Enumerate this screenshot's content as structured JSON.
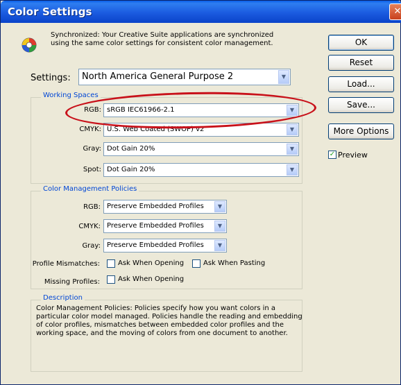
{
  "window": {
    "title": "Color Settings",
    "close": "✕"
  },
  "sync": {
    "text": "Synchronized: Your Creative Suite applications are synchronized using the same color settings for consistent color management."
  },
  "settings": {
    "label": "Settings:",
    "value": "North America General Purpose 2"
  },
  "working_spaces": {
    "legend": "Working Spaces",
    "rgb": {
      "label": "RGB:",
      "value": "sRGB IEC61966-2.1"
    },
    "cmyk": {
      "label": "CMYK:",
      "value": "U.S. Web Coated (SWOP) v2"
    },
    "gray": {
      "label": "Gray:",
      "value": "Dot Gain 20%"
    },
    "spot": {
      "label": "Spot:",
      "value": "Dot Gain 20%"
    }
  },
  "policies": {
    "legend": "Color Management Policies",
    "rgb": {
      "label": "RGB:",
      "value": "Preserve Embedded Profiles"
    },
    "cmyk": {
      "label": "CMYK:",
      "value": "Preserve Embedded Profiles"
    },
    "gray": {
      "label": "Gray:",
      "value": "Preserve Embedded Profiles"
    },
    "profile_mismatches": {
      "label": "Profile Mismatches:",
      "ask_opening": "Ask When Opening",
      "ask_pasting": "Ask When Pasting",
      "ask_opening_checked": false,
      "ask_pasting_checked": false
    },
    "missing_profiles": {
      "label": "Missing Profiles:",
      "ask_opening": "Ask When Opening",
      "ask_opening_checked": false
    }
  },
  "description": {
    "legend": "Description",
    "text": "Color Management Policies: Policies specify how you want colors in a particular color model managed. Policies handle the reading and embedding of color profiles, mismatches between embedded color profiles and the working space, and the moving of colors from one document to another."
  },
  "buttons": {
    "ok": "OK",
    "reset": "Reset",
    "load": "Load...",
    "save": "Save...",
    "more_options": "More Options"
  },
  "preview": {
    "label": "Preview",
    "checked": true
  },
  "colors": {
    "title_bar": "#0A5FEA",
    "dialog_bg": "#ECE9D8",
    "legend_text": "#0046D5",
    "highlight_oval": "#C8111A"
  }
}
